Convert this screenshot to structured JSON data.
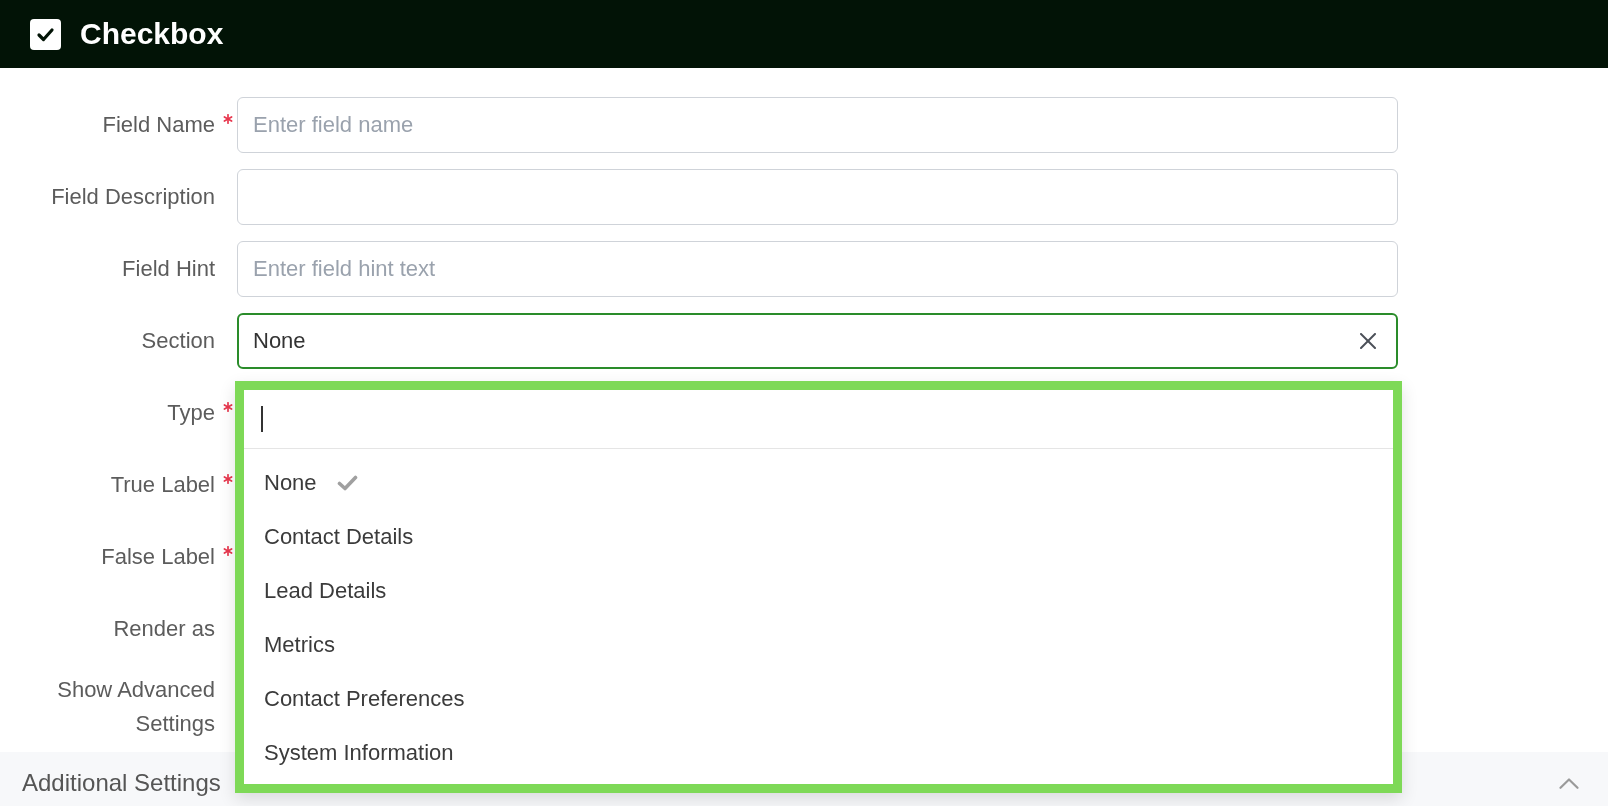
{
  "header": {
    "title": "Checkbox"
  },
  "fields": [
    {
      "label": "Field Name",
      "required": true,
      "kind": "text",
      "placeholder": "Enter field name"
    },
    {
      "label": "Field Description",
      "required": false,
      "kind": "text"
    },
    {
      "label": "Field Hint",
      "required": false,
      "kind": "text",
      "placeholder": "Enter field hint text"
    },
    {
      "label": "Section",
      "required": false,
      "kind": "select",
      "value": "None",
      "focused": true,
      "expanded": true,
      "search": {
        "focused": true
      },
      "options": [
        {
          "label": "None",
          "selected": true
        },
        {
          "label": "Contact Details",
          "selected": false
        },
        {
          "label": "Lead Details",
          "selected": false
        },
        {
          "label": "Metrics",
          "selected": false
        },
        {
          "label": "Contact Preferences",
          "selected": false
        },
        {
          "label": "System Information",
          "selected": false
        }
      ]
    }
  ],
  "more_fields": [
    {
      "label": "Type",
      "required": true
    },
    {
      "label": "True Label",
      "required": true
    },
    {
      "label": "False Label",
      "required": true
    },
    {
      "label": "Render as",
      "required": false
    },
    {
      "label": "Show Advanced Settings",
      "required": false
    }
  ],
  "additional_settings": {
    "title": "Additional Settings",
    "expanded": true
  }
}
